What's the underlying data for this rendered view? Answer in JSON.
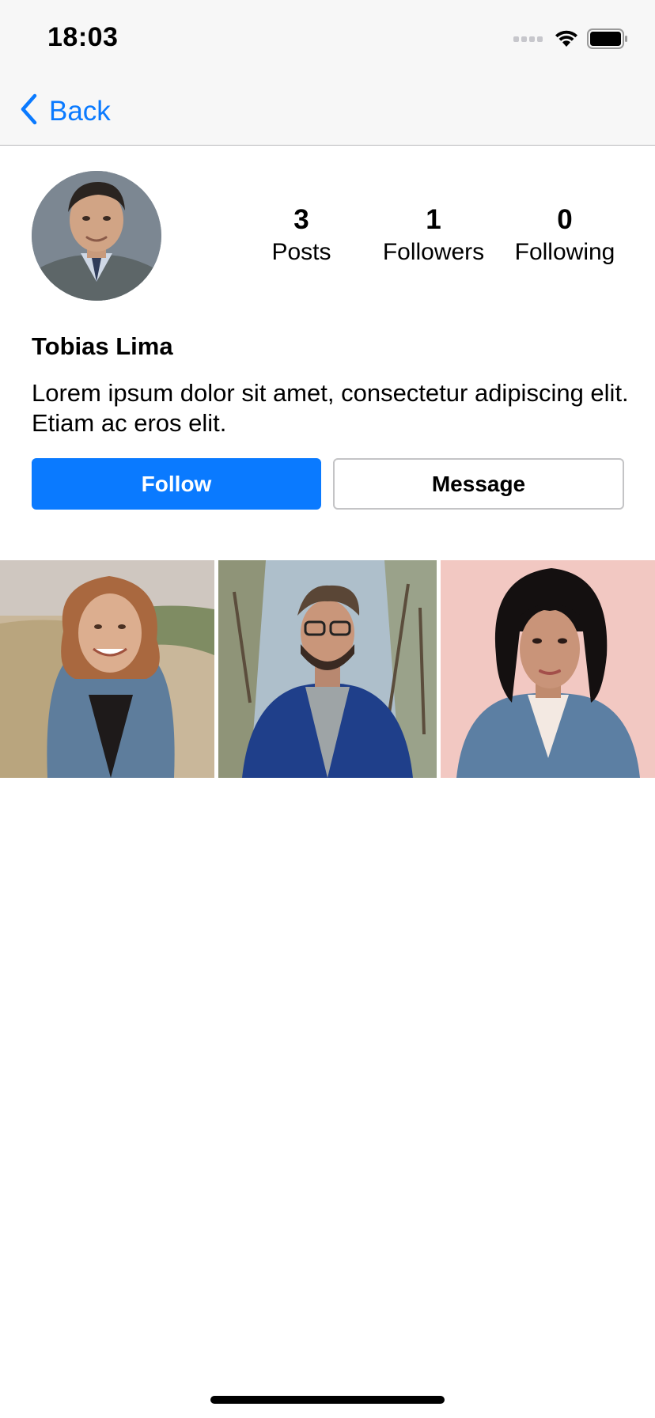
{
  "status_bar": {
    "time": "18:03",
    "icons": [
      "cellular-signal-icon",
      "wifi-icon",
      "battery-icon"
    ]
  },
  "nav": {
    "back_label": "Back",
    "back_icon": "chevron-left-icon"
  },
  "profile": {
    "avatar": "avatar",
    "name": "Tobias Lima",
    "bio": "Lorem ipsum dolor sit amet, consectetur adipiscing elit. Etiam ac eros elit.",
    "stats": {
      "posts": {
        "count": "3",
        "label": "Posts"
      },
      "followers": {
        "count": "1",
        "label": "Followers"
      },
      "following": {
        "count": "0",
        "label": "Following"
      }
    }
  },
  "actions": {
    "follow_label": "Follow",
    "message_label": "Message"
  },
  "posts": [
    {
      "name": "post-photo"
    },
    {
      "name": "post-photo"
    },
    {
      "name": "post-photo"
    }
  ],
  "colors": {
    "accent": "#0a7aff",
    "header_bg": "#f7f7f7",
    "border": "#c4c4c6"
  }
}
